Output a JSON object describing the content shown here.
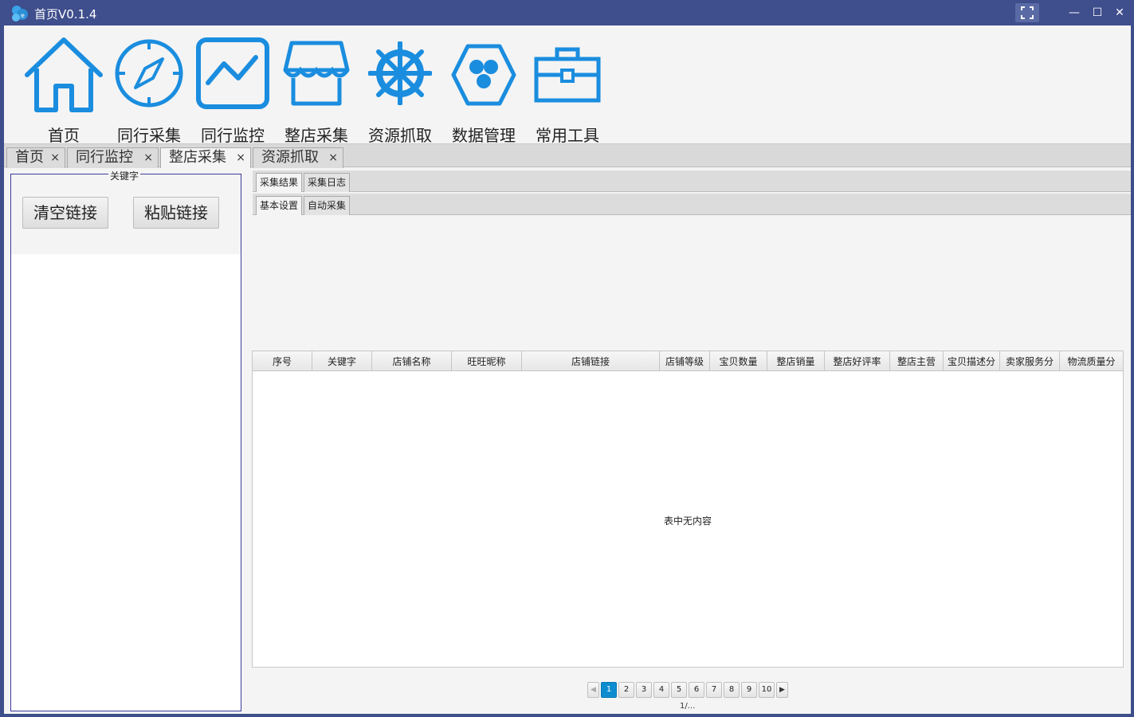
{
  "window": {
    "title": "首页V0.1.4",
    "fullscreen_icon": "fullscreen-icon",
    "minimize_label": "—",
    "maximize_label": "☐",
    "close_label": "✕"
  },
  "toolbar": {
    "items": [
      {
        "label": "首页",
        "icon": "home-icon"
      },
      {
        "label": "同行采集",
        "icon": "compass-icon"
      },
      {
        "label": "同行监控",
        "icon": "chart-monitor-icon"
      },
      {
        "label": "整店采集",
        "icon": "shop-icon"
      },
      {
        "label": "资源抓取",
        "icon": "ship-wheel-icon"
      },
      {
        "label": "数据管理",
        "icon": "hexagon-icon"
      },
      {
        "label": "常用工具",
        "icon": "toolbox-icon"
      }
    ],
    "accent_color": "#1a8ddf"
  },
  "main_tabs": [
    {
      "label": "首页",
      "close": "×"
    },
    {
      "label": "同行监控",
      "close": "×"
    },
    {
      "label": "整店采集",
      "close": "×",
      "active": true
    },
    {
      "label": "资源抓取",
      "close": "×"
    }
  ],
  "left_panel": {
    "legend": "关键字",
    "clear_button": "清空链接",
    "paste_button": "粘贴链接"
  },
  "sub_tabs_top": [
    {
      "label": "采集结果",
      "active": true
    },
    {
      "label": "采集日志"
    }
  ],
  "sub_tabs_bottom": [
    {
      "label": "基本设置",
      "active": true
    },
    {
      "label": "自动采集"
    }
  ],
  "table": {
    "columns": [
      "序号",
      "关键字",
      "店铺名称",
      "旺旺昵称",
      "店铺链接",
      "店铺等级",
      "宝贝数量",
      "整店销量",
      "整店好评率",
      "整店主营",
      "宝贝描述分",
      "卖家服务分",
      "物流质量分"
    ],
    "empty_text": "表中无内容"
  },
  "pagination": {
    "prev": "◀",
    "next": "▶",
    "pages": [
      "1",
      "2",
      "3",
      "4",
      "5",
      "6",
      "7",
      "8",
      "9",
      "10"
    ],
    "current": "1",
    "info": "1/..."
  }
}
